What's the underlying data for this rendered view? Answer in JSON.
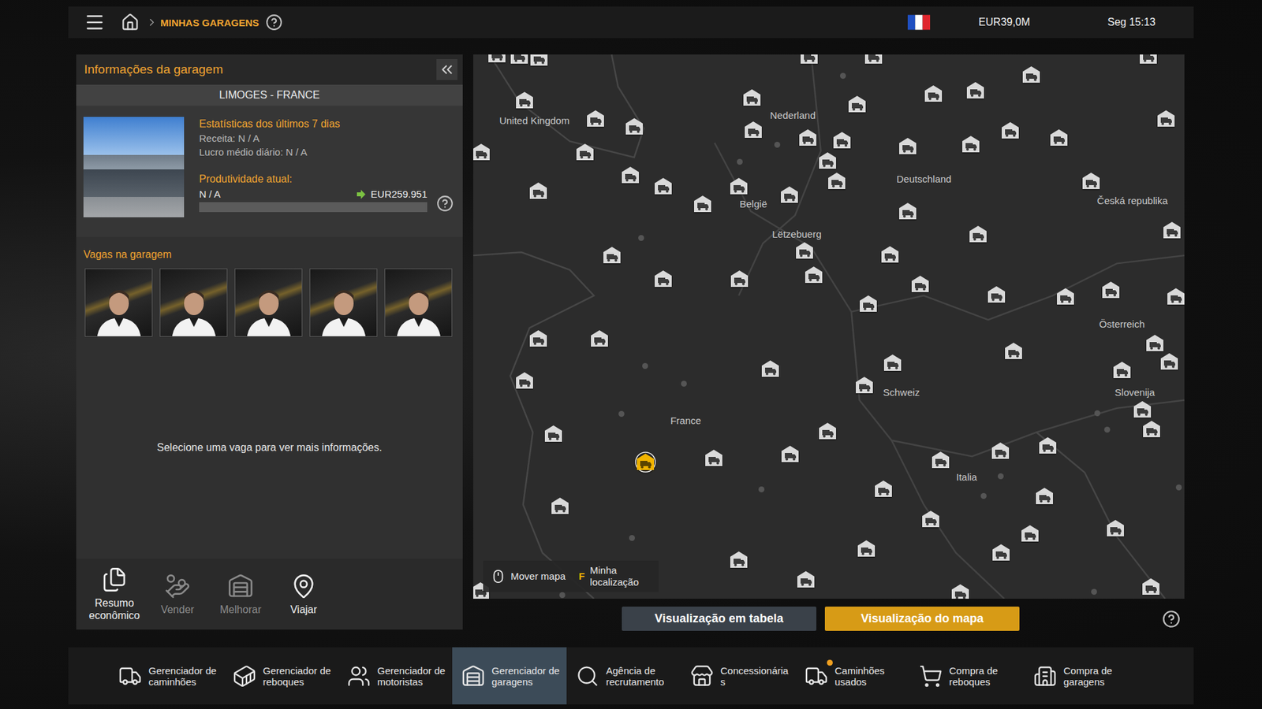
{
  "top_bar": {
    "breadcrumb": "MINHAS GARAGENS",
    "money": "EUR39,0M",
    "clock": "Seg 15:13"
  },
  "garage_panel": {
    "title": "Informações da garagem",
    "location": "LIMOGES - FRANCE",
    "stats_title": "Estatísticas dos últimos 7 dias",
    "stats": [
      "Receita: N / A",
      "Lucro médio diário: N / A"
    ],
    "productivity": {
      "label": "Produtividade atual:",
      "value": "N / A",
      "target": "EUR259.951",
      "level": 0
    },
    "slots_title": "Vagas na garagem",
    "slots": [
      {
        "occupied": true
      },
      {
        "occupied": true
      },
      {
        "occupied": true
      },
      {
        "occupied": true
      },
      {
        "occupied": true
      }
    ],
    "hint": "Selecione uma vaga para ver mais informações.",
    "actions": [
      {
        "label": "Resumo econômico",
        "disabled": false
      },
      {
        "label": "Vender",
        "disabled": true
      },
      {
        "label": "Melhorar",
        "disabled": true
      },
      {
        "label": "Viajar",
        "disabled": false
      }
    ]
  },
  "map": {
    "labels": [
      "United Kingdom",
      "Nederland",
      "Deutschland",
      "België",
      "Lëtzebuerg",
      "Česká republika",
      "Österreich",
      "Schweiz",
      "France",
      "Italia",
      "Slovenija"
    ],
    "garages": [
      {
        "selected": false
      },
      {
        "selected": false
      },
      {
        "selected": false
      },
      {
        "selected": false
      },
      {
        "selected": false
      },
      {
        "selected": false
      },
      {
        "selected": false
      },
      {
        "selected": false
      },
      {
        "selected": false
      },
      {
        "selected": false
      },
      {
        "selected": false
      },
      {
        "selected": false
      },
      {
        "selected": false
      },
      {
        "selected": false
      },
      {
        "selected": false
      },
      {
        "selected": false
      },
      {
        "selected": false
      },
      {
        "selected": false
      },
      {
        "selected": false
      },
      {
        "selected": false
      },
      {
        "selected": false
      },
      {
        "selected": false
      },
      {
        "selected": false
      },
      {
        "selected": false
      },
      {
        "selected": false
      },
      {
        "selected": false
      },
      {
        "selected": false
      },
      {
        "selected": false
      },
      {
        "selected": false
      },
      {
        "selected": false
      },
      {
        "selected": false
      },
      {
        "selected": false
      },
      {
        "selected": false
      },
      {
        "selected": false
      },
      {
        "selected": false
      },
      {
        "selected": false
      },
      {
        "selected": false
      },
      {
        "selected": false
      },
      {
        "selected": false
      },
      {
        "selected": false
      },
      {
        "selected": false
      },
      {
        "selected": false
      },
      {
        "selected": false
      },
      {
        "selected": false
      },
      {
        "selected": false
      },
      {
        "selected": false
      },
      {
        "selected": false
      },
      {
        "selected": false
      },
      {
        "selected": false
      },
      {
        "selected": false
      },
      {
        "selected": false
      },
      {
        "selected": false
      },
      {
        "selected": false
      },
      {
        "selected": false
      },
      {
        "selected": false
      },
      {
        "selected": false
      },
      {
        "selected": false
      },
      {
        "selected": false
      },
      {
        "selected": false
      },
      {
        "selected": false
      },
      {
        "selected": false
      },
      {
        "selected": false
      },
      {
        "selected": false
      },
      {
        "selected": false
      },
      {
        "selected": false
      },
      {
        "selected": false
      },
      {
        "selected": false
      },
      {
        "selected": true
      },
      {
        "selected": false
      },
      {
        "selected": false
      },
      {
        "selected": false
      },
      {
        "selected": false
      },
      {
        "selected": false
      },
      {
        "selected": false
      },
      {
        "selected": false
      },
      {
        "selected": false
      },
      {
        "selected": false
      },
      {
        "selected": false
      },
      {
        "selected": false
      },
      {
        "selected": false
      },
      {
        "selected": false
      }
    ],
    "controls": [
      {
        "kind": "mouse",
        "key": "",
        "label": "Mover mapa"
      },
      {
        "kind": "key",
        "key": "F",
        "label": "Minha localização"
      }
    ]
  },
  "views": [
    {
      "label": "Visualização em tabela",
      "selected": false
    },
    {
      "label": "Visualização do mapa",
      "selected": true
    }
  ],
  "toolbar": [
    {
      "label": "Gerenciador de caminhões",
      "selected": false,
      "badge": false
    },
    {
      "label": "Gerenciador de reboques",
      "selected": false,
      "badge": false
    },
    {
      "label": "Gerenciador de motoristas",
      "selected": false,
      "badge": false
    },
    {
      "label": "Gerenciador de garagens",
      "selected": true,
      "badge": false
    },
    {
      "label": "Agência de recrutamento",
      "selected": false,
      "badge": false
    },
    {
      "label": "Concessionárias",
      "selected": false,
      "badge": false
    },
    {
      "label": "Caminhões usados",
      "selected": false,
      "badge": true
    },
    {
      "label": "Compra de reboques",
      "selected": false,
      "badge": false
    },
    {
      "label": "Compra de garagens",
      "selected": false,
      "badge": false
    }
  ]
}
